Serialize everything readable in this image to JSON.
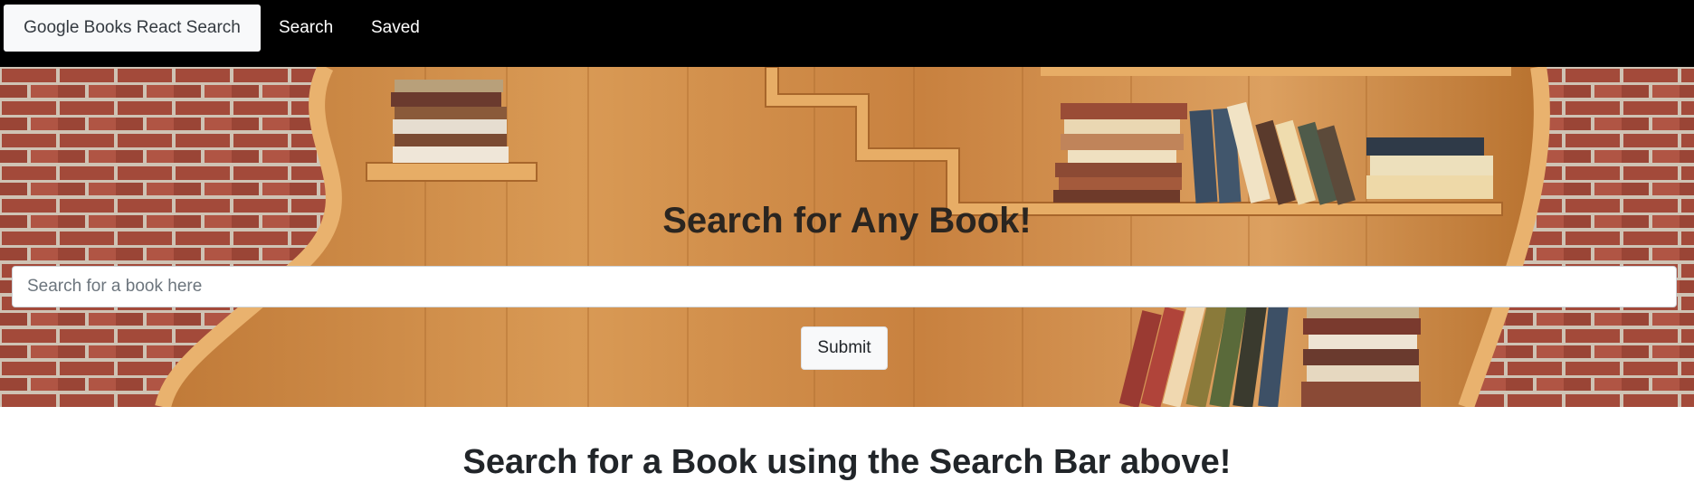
{
  "navbar": {
    "brand": "Google Books React Search",
    "links": [
      {
        "label": "Search"
      },
      {
        "label": "Saved"
      }
    ]
  },
  "hero": {
    "title": "Search for Any Book!",
    "search": {
      "placeholder": "Search for a book here",
      "value": ""
    },
    "submit_label": "Submit"
  },
  "main": {
    "heading": "Search for a Book using the Search Bar above!"
  },
  "colors": {
    "navbar_bg": "#000000",
    "brand_bg": "#f8f9fa",
    "wood": "#c9843f",
    "brick": "#9e4b3b"
  }
}
